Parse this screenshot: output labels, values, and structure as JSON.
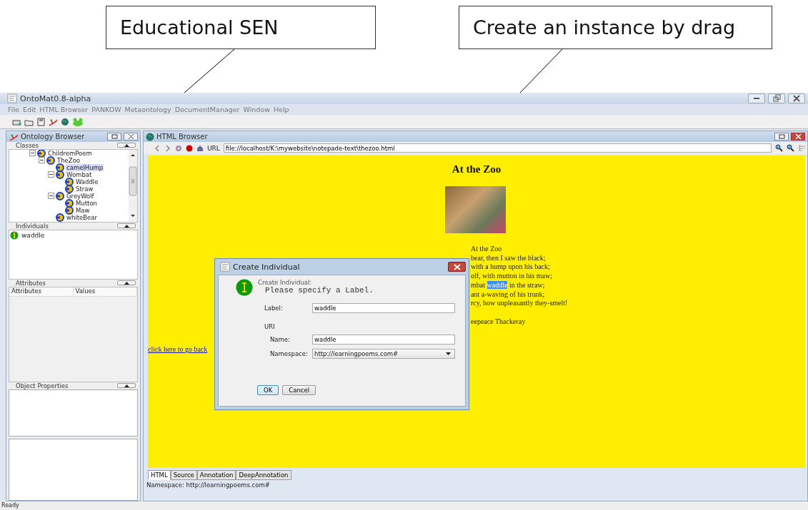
{
  "annotations": [
    {
      "text": "Educational SEN"
    },
    {
      "text": "Create an instance by drag"
    }
  ],
  "window": {
    "title": "OntoMat0.8-alpha"
  },
  "menu": [
    "File",
    "Edit",
    "HTML Browser",
    "PANKOW",
    "Metaontology",
    "DocumentManager",
    "Window",
    "Help"
  ],
  "toolbar": [
    {
      "kind": "open"
    },
    {
      "kind": "folder"
    },
    {
      "kind": "save"
    },
    {
      "kind": "plant"
    },
    {
      "kind": "globe"
    },
    {
      "kind": "frog"
    }
  ],
  "ontology_browser": {
    "title": "Ontology Browser",
    "classes": {
      "title": "Classes",
      "tree": [
        {
          "label": "ChildremPoem",
          "selected": false,
          "expanded": true,
          "children": [
            {
              "label": "TheZoo",
              "selected": false,
              "expanded": true,
              "children": [
                {
                  "label": "camelHump",
                  "selected": true
                },
                {
                  "label": "Wombat",
                  "selected": false,
                  "expanded": true,
                  "children": [
                    {
                      "label": "Waddle",
                      "selected": false
                    },
                    {
                      "label": "Straw",
                      "selected": false
                    }
                  ]
                },
                {
                  "label": "GreyWolf",
                  "selected": false,
                  "expanded": true,
                  "children": [
                    {
                      "label": "Mutton",
                      "selected": false
                    },
                    {
                      "label": "Maw",
                      "selected": false
                    }
                  ]
                },
                {
                  "label": "whiteBear",
                  "selected": false
                }
              ]
            }
          ]
        }
      ]
    },
    "individuals": {
      "title": "Individuals",
      "items": [
        {
          "label": "waddle"
        }
      ]
    },
    "attributes": {
      "title": "Attributes",
      "columns": [
        "Attributes",
        "Values"
      ]
    },
    "object_properties": {
      "title": "Object Properties"
    }
  },
  "html_browser": {
    "title": "HTML Browser",
    "url_label": "URL",
    "url": "file://localhost/K:\\mywebsite\\notepade-text\\thezoo.html",
    "page": {
      "heading": "At the Zoo",
      "poem": [
        [
          [
            {
              "text": "At the Zoo",
              "highlighted": false
            }
          ],
          [
            {
              "text": "bear, then I saw the black;",
              "highlighted": false
            }
          ],
          [
            {
              "text": "with a hump upon his back;",
              "highlighted": false
            }
          ],
          [
            {
              "text": "olf, with mutton in his maw;",
              "highlighted": false
            }
          ],
          [
            {
              "text": "mbat ",
              "highlighted": false
            },
            {
              "text": "waddle",
              "highlighted": true
            },
            {
              "text": " in the straw;",
              "highlighted": false
            }
          ],
          [
            {
              "text": "ant a-waving of his trunk;",
              "highlighted": false
            }
          ],
          [
            {
              "text": "rcy, how unpleasantly they-smelt!",
              "highlighted": false
            }
          ]
        ],
        [
          [
            {
              "text": "eepeace Thackeray",
              "highlighted": false
            }
          ]
        ]
      ],
      "link": "click here to go back"
    },
    "tabs": [
      {
        "label": "HTML",
        "selected": true
      },
      {
        "label": "Source",
        "selected": false
      },
      {
        "label": "Annotation",
        "selected": false
      },
      {
        "label": "DeepAnnotation",
        "selected": false
      }
    ],
    "namespace": "Namespace: http://learningpoems.com#"
  },
  "dialog": {
    "title": "Create Individual",
    "heading": "Create Individual:",
    "message": "Please specify a Label.",
    "label_caption": "Label:",
    "label_value": "waddle",
    "uri_caption": "URI",
    "name_caption": "Name:",
    "name_value": "waddle",
    "namespace_caption": "Namespace:",
    "namespace_value": "http://learningpoems.com#",
    "buttons": [
      {
        "label": "OK",
        "selected": true
      },
      {
        "label": "Cancel",
        "selected": false
      }
    ]
  },
  "status_bar": {
    "text": "Ready"
  }
}
